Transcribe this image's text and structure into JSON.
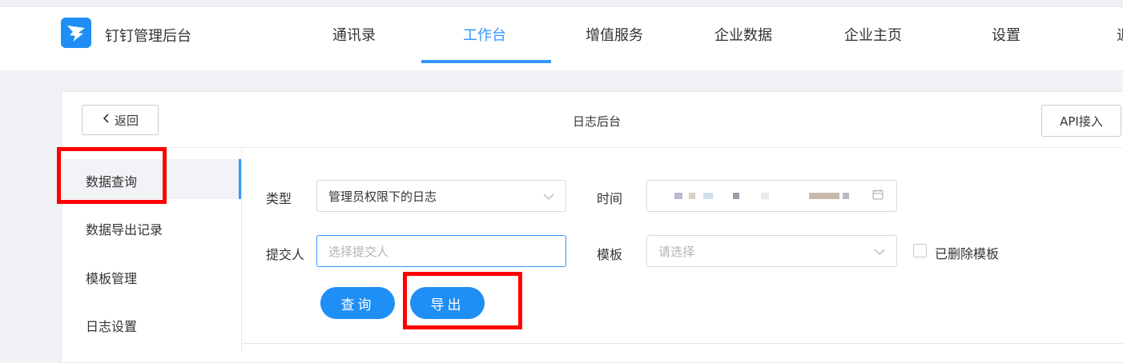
{
  "header": {
    "brand": "钉钉管理后台",
    "nav": [
      {
        "label": "通讯录",
        "active": false
      },
      {
        "label": "工作台",
        "active": true
      },
      {
        "label": "增值服务",
        "active": false
      },
      {
        "label": "企业数据",
        "active": false
      },
      {
        "label": "企业主页",
        "active": false
      },
      {
        "label": "设置",
        "active": false
      },
      {
        "label": "退",
        "active": false
      }
    ]
  },
  "toolbar": {
    "back_label": "返回",
    "page_title": "日志后台",
    "api_label": "API接入"
  },
  "sidebar": {
    "items": [
      {
        "label": "数据查询",
        "active": true
      },
      {
        "label": "数据导出记录",
        "active": false
      },
      {
        "label": "模板管理",
        "active": false
      },
      {
        "label": "日志设置",
        "active": false
      }
    ]
  },
  "filters": {
    "type_label": "类型",
    "type_value": "管理员权限下的日志",
    "time_label": "时间",
    "submitter_label": "提交人",
    "submitter_placeholder": "选择提交人",
    "template_label": "模板",
    "template_placeholder": "请选择",
    "deleted_templates_label": "已删除模板"
  },
  "actions": {
    "query_label": "查询",
    "export_label": "导出"
  },
  "colors": {
    "accent": "#3296fa",
    "button": "#1f8ef5",
    "highlight": "#ff0000"
  }
}
